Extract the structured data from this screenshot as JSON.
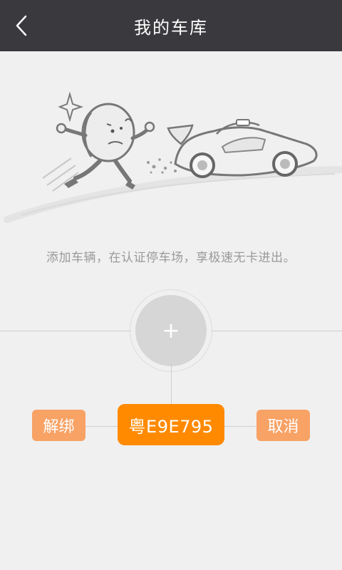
{
  "header": {
    "title": "我的车库",
    "back_icon": "chevron-left-icon"
  },
  "main": {
    "description": "添加车辆，在认证停车场，享极速无卡进出。",
    "add_icon_glyph": "+"
  },
  "actions": {
    "unbind_label": "解绑",
    "plate_label": "粤E9E795",
    "cancel_label": "取消"
  },
  "colors": {
    "header_bg": "#3a393e",
    "accent_orange": "#ff8a00",
    "soft_orange": "#f8a265",
    "add_circle": "#d6d6d6"
  }
}
